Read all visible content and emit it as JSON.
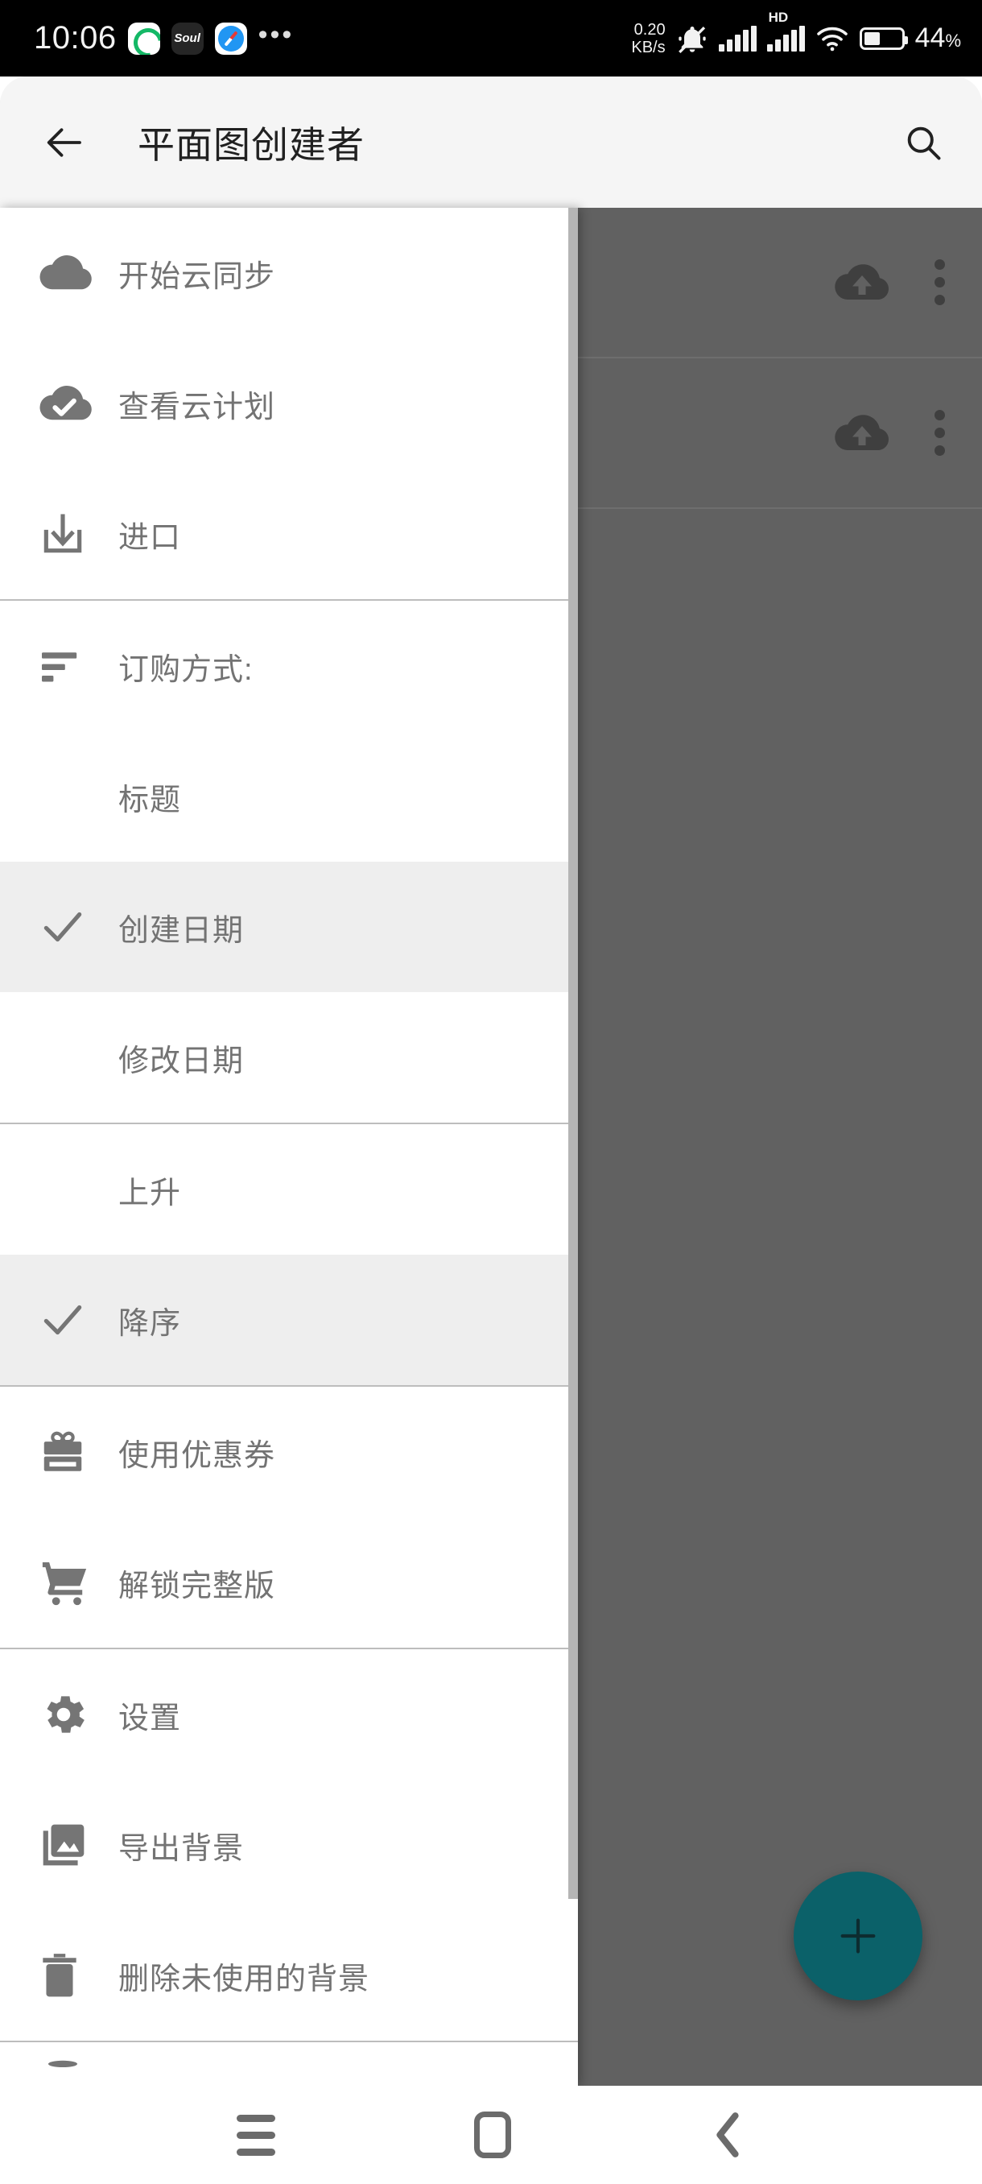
{
  "status_bar": {
    "time": "10:06",
    "app_icons": [
      "green-circle-app-icon",
      "soul-app-icon",
      "safari-app-icon"
    ],
    "overflow_dots": "•••",
    "net_speed_value": "0.20",
    "net_speed_unit": "KB/s",
    "mute_icon": "bell-muted-icon",
    "signal_icon": "signal-bars-icon",
    "hd_label": "HD",
    "hd_signal_icon": "signal-bars-icon",
    "wifi_icon": "wifi-icon",
    "battery_icon": "battery-icon",
    "battery_percent": "44",
    "battery_percent_symbol": "%"
  },
  "app_bar": {
    "back_icon": "back-arrow-icon",
    "title": "平面图创建者",
    "search_icon": "search-icon"
  },
  "drawer": {
    "groups": [
      {
        "items": [
          {
            "label": "开始云同步",
            "icon": "cloud-icon",
            "selected": false,
            "indented": false
          },
          {
            "label": "查看云计划",
            "icon": "cloud-check-icon",
            "selected": false,
            "indented": false
          },
          {
            "label": "进口",
            "icon": "import-download-icon",
            "selected": false,
            "indented": false
          }
        ]
      },
      {
        "items": [
          {
            "label": "订购方式:",
            "icon": "sort-icon",
            "selected": false,
            "indented": false
          },
          {
            "label": "标题",
            "icon": "",
            "selected": false,
            "indented": true
          },
          {
            "label": "创建日期",
            "icon": "check-icon",
            "selected": true,
            "indented": false
          },
          {
            "label": "修改日期",
            "icon": "",
            "selected": false,
            "indented": true
          }
        ]
      },
      {
        "items": [
          {
            "label": "上升",
            "icon": "",
            "selected": false,
            "indented": true
          },
          {
            "label": "降序",
            "icon": "check-icon",
            "selected": true,
            "indented": false
          }
        ]
      },
      {
        "items": [
          {
            "label": "使用优惠券",
            "icon": "gift-icon",
            "selected": false,
            "indented": false
          },
          {
            "label": "解锁完整版",
            "icon": "shopping-cart-icon",
            "selected": false,
            "indented": false
          }
        ]
      },
      {
        "items": [
          {
            "label": "设置",
            "icon": "gear-icon",
            "selected": false,
            "indented": false
          },
          {
            "label": "导出背景",
            "icon": "image-export-icon",
            "selected": false,
            "indented": false
          },
          {
            "label": "删除未使用的背景",
            "icon": "trash-icon",
            "selected": false,
            "indented": false
          }
        ]
      }
    ],
    "scrollbar": "drawer-scrollbar"
  },
  "content": {
    "rows": [
      {
        "cloud_icon": "cloud-upload-icon",
        "menu_icon": "kebab-menu-icon"
      },
      {
        "cloud_icon": "cloud-upload-icon",
        "menu_icon": "kebab-menu-icon"
      }
    ],
    "fab_icon": "plus-icon",
    "fab_color": "#0b6169",
    "overlay_color": "#616161"
  },
  "nav_bar": {
    "recents_icon": "recents-hamburger-icon",
    "home_icon": "home-square-icon",
    "back_icon": "back-chevron-icon"
  }
}
